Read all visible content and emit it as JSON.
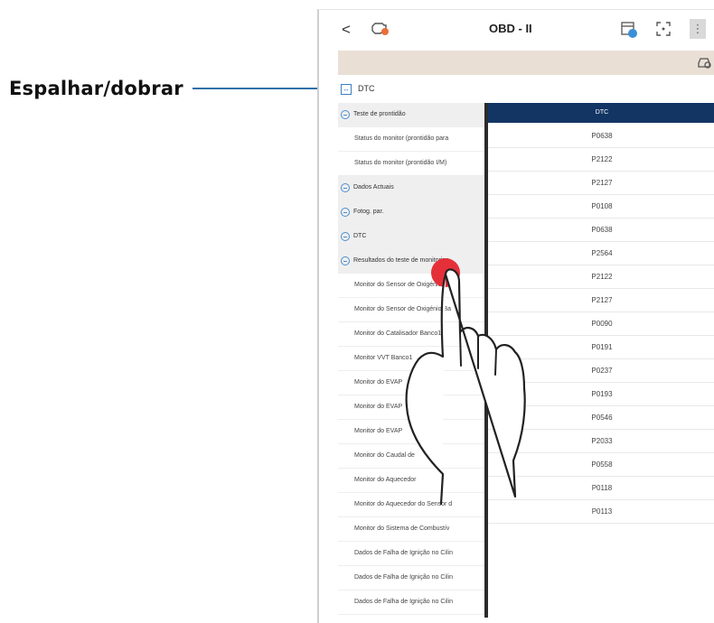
{
  "callout": {
    "label": "Espalhar/dobrar"
  },
  "topbar": {
    "back_label": "<",
    "title": "OBD - II",
    "menu_label": "⋮"
  },
  "toggle": {
    "icon_label": "↔",
    "label": "DTC"
  },
  "tree": {
    "rows": [
      {
        "kind": "group",
        "label": "Teste de prontidão"
      },
      {
        "kind": "child",
        "label": "Status do monitor (prontidão para"
      },
      {
        "kind": "child",
        "label": "Status do monitor (prontidão I/M)"
      },
      {
        "kind": "group",
        "label": "Dados Actuais"
      },
      {
        "kind": "group",
        "label": "Fotog. par."
      },
      {
        "kind": "group",
        "label": "DTC"
      },
      {
        "kind": "group",
        "label": "Resultados do teste de monitoriza"
      },
      {
        "kind": "child",
        "label": "Monitor do Sensor de Oxigénio Ba"
      },
      {
        "kind": "child",
        "label": "Monitor do Sensor de Oxigénio Ba"
      },
      {
        "kind": "child",
        "label": "Monitor do Catalisador Banco1"
      },
      {
        "kind": "child",
        "label": "Monitor VVT Banco1"
      },
      {
        "kind": "child",
        "label": "Monitor do EVAP"
      },
      {
        "kind": "child",
        "label": "Monitor do EVAP"
      },
      {
        "kind": "child",
        "label": "Monitor do EVAP"
      },
      {
        "kind": "child",
        "label": "Monitor do Caudal de"
      },
      {
        "kind": "child",
        "label": "Monitor do Aquecedor"
      },
      {
        "kind": "child",
        "label": "Monitor do Aquecedor do Sensor d"
      },
      {
        "kind": "child",
        "label": "Monitor do Sistema de Combustív"
      },
      {
        "kind": "child",
        "label": "Dados de Falha de Ignição no Cilin"
      },
      {
        "kind": "child",
        "label": "Dados de Falha de Ignição no Cilin"
      },
      {
        "kind": "child",
        "label": "Dados de Falha de Ignição no Cilin"
      }
    ]
  },
  "dtc_table": {
    "header": "DTC",
    "codes": [
      "P0638",
      "P2122",
      "P2127",
      "P0108",
      "P0638",
      "P2564",
      "P2122",
      "P2127",
      "P0090",
      "P0191",
      "P0237",
      "P0193",
      "P0546",
      "P2033",
      "P0558",
      "P0118",
      "P0113"
    ]
  },
  "colors": {
    "callout_line": "#2f6fa8",
    "table_header": "#123564",
    "info_bar": "#e9dfd5",
    "touch_point": "#e5303a"
  },
  "icons": [
    "chevron-left-icon",
    "engine-warning-icon",
    "calendar-icon",
    "screenshot-icon",
    "car-search-icon",
    "expand-collapse-icon",
    "minus-circle-icon",
    "hand-gesture-icon"
  ]
}
